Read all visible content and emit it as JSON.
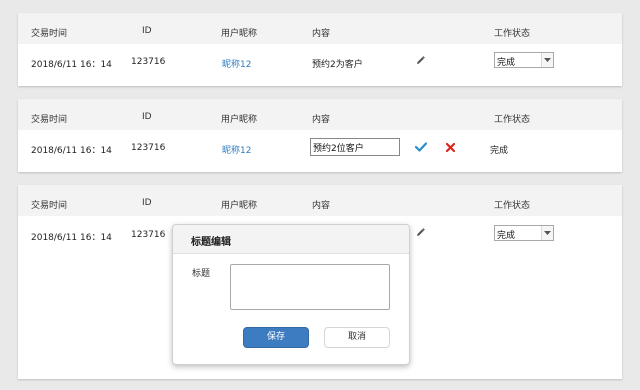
{
  "columns": {
    "time": "交易时间",
    "id": "ID",
    "nickname": "用户昵称",
    "content": "内容",
    "status": "工作状态"
  },
  "rows": [
    {
      "time": "2018/6/11 16：14",
      "id": "123716",
      "nickname": "昵称12",
      "content": "预约2为客户",
      "status": "完成",
      "mode": "view"
    },
    {
      "time": "2018/6/11 16：14",
      "id": "123716",
      "nickname": "昵称12",
      "content": "预约2位客户",
      "status": "完成",
      "mode": "editing"
    },
    {
      "time": "2018/6/11 16：14",
      "id": "123716",
      "status": "完成",
      "mode": "view"
    }
  ],
  "dialog": {
    "title": "标题编辑",
    "field_label": "标题",
    "field_value": "",
    "save_label": "保存",
    "cancel_label": "取消"
  },
  "icons": {
    "edit": "pencil-icon",
    "confirm": "checkmark-icon",
    "cancel": "cross-icon",
    "dropdown": "chevron-down-icon"
  },
  "colors": {
    "link": "#2f7dc0",
    "confirm": "#2b8fc7",
    "cancel": "#d9261c",
    "primary_button": "#3d7cc0"
  }
}
